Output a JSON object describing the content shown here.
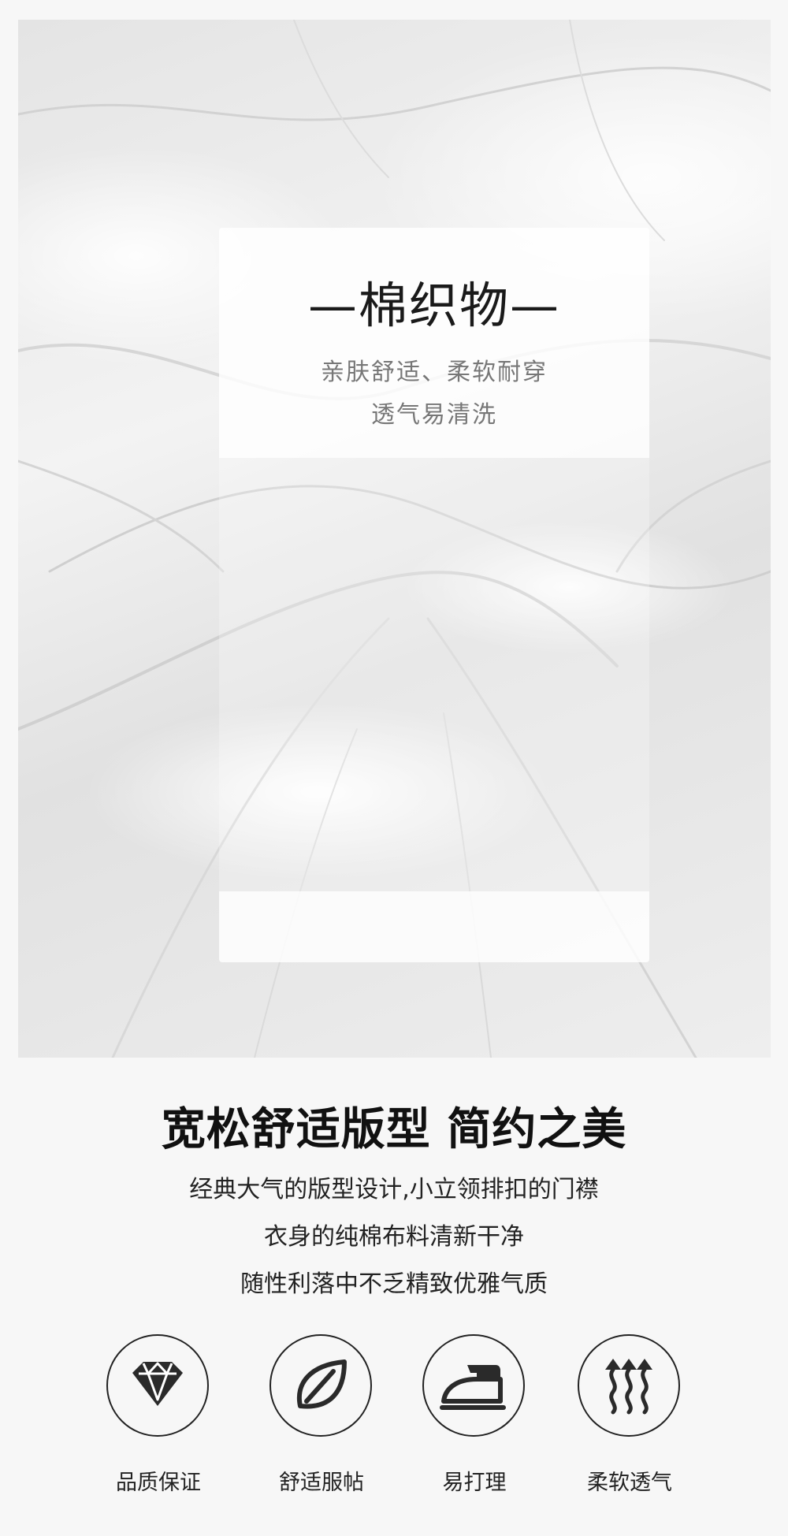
{
  "hero": {
    "title": "—棉织物—",
    "desc_line1": "亲肤舒适、柔软耐穿",
    "desc_line2": "透气易清洗"
  },
  "headline": "宽松舒适版型 简约之美",
  "description": [
    "经典大气的版型设计,小立领排扣的门襟",
    "衣身的纯棉布料清新干净",
    "随性利落中不乏精致优雅气质"
  ],
  "features": [
    {
      "icon": "diamond-icon",
      "label": "品质保证"
    },
    {
      "icon": "leaf-icon",
      "label": "舒适服帖"
    },
    {
      "icon": "iron-icon",
      "label": "易打理"
    },
    {
      "icon": "breathable-arrows-icon",
      "label": "柔软透气"
    }
  ]
}
